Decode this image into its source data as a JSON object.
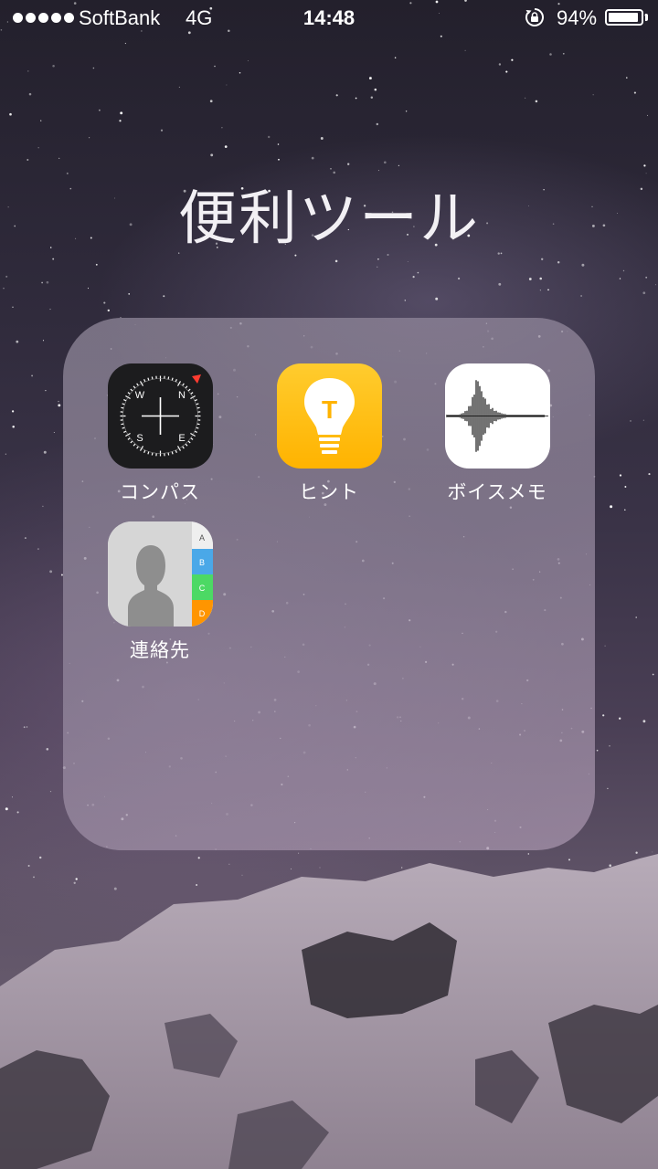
{
  "status_bar": {
    "carrier": "SoftBank",
    "network": "4G",
    "time": "14:48",
    "battery_percent_label": "94%",
    "battery_level": 0.94,
    "signal_bars": 5
  },
  "folder": {
    "title": "便利ツール",
    "apps": [
      {
        "label": "コンパス",
        "icon": "compass-icon"
      },
      {
        "label": "ヒント",
        "icon": "lightbulb-icon"
      },
      {
        "label": "ボイスメモ",
        "icon": "waveform-icon"
      },
      {
        "label": "連絡先",
        "icon": "contacts-icon"
      }
    ]
  },
  "icons": {
    "compass_letters": {
      "n": "N",
      "e": "E",
      "s": "S",
      "w": "W"
    },
    "tips_letter": "T",
    "contacts_tabs": [
      "A",
      "B",
      "C",
      "D"
    ]
  },
  "colors": {
    "tips_yellow": "#ffc107",
    "compass_needle": "#ff3b30",
    "contacts_tab_b": "#4aa8e8",
    "contacts_tab_c": "#4cd964",
    "contacts_tab_d": "#ff9500"
  }
}
